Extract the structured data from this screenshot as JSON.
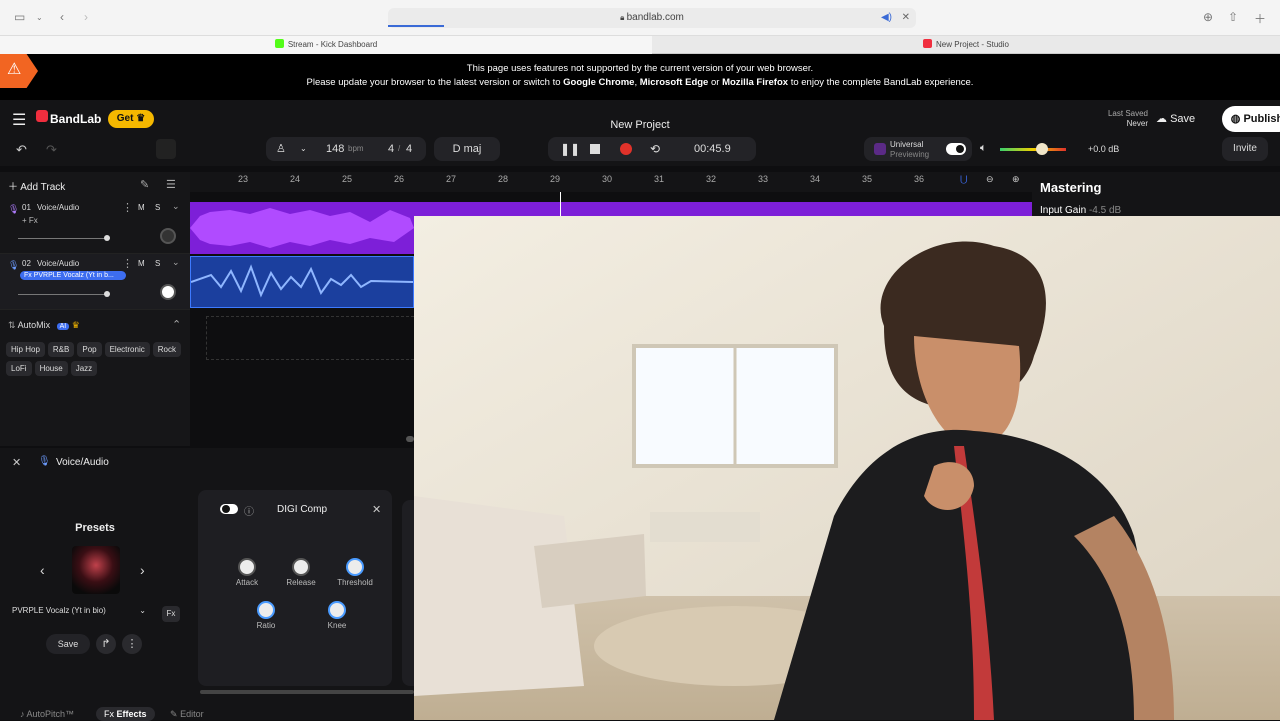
{
  "browser": {
    "url": "bandlab.com",
    "tabs": [
      {
        "label": "Stream - Kick Dashboard",
        "color": "#53fc18"
      },
      {
        "label": "New Project - Studio",
        "color": "#f02e3e"
      }
    ]
  },
  "notice": {
    "line1": "This page uses features not supported by the current version of your web browser.",
    "line2_a": "Please update your browser to the latest version or switch to ",
    "chrome": "Google Chrome",
    "comma": ", ",
    "edge": "Microsoft Edge",
    "or": " or ",
    "firefox": "Mozilla Firefox",
    "line2_b": " to enjoy the complete BandLab experience."
  },
  "header": {
    "brand": "BandLab",
    "get_label": "Get",
    "project_title": "New Project",
    "last_saved_label": "Last Saved",
    "last_saved_value": "Never",
    "save_label": "Save",
    "publish_label": "Publish",
    "invite_label": "Invite"
  },
  "transport": {
    "bpm": "148",
    "bpm_unit": "bpm",
    "time_sig_num": "4",
    "time_sig_sep": "/",
    "time_sig_den": "4",
    "key": "D maj",
    "time": "00:45.9",
    "universal_label": "Universal",
    "universal_sub": "Previewing",
    "volume_db": "+0.0 dB"
  },
  "tracks_panel": {
    "add_track": "Add Track",
    "tracks": [
      {
        "number": "01",
        "name": "Voice/Audio",
        "fx": "+ Fx",
        "m": "M",
        "s": "S"
      },
      {
        "number": "02",
        "name": "Voice/Audio",
        "fx": "Fx PVRPLE Vocalz (Yt in b...",
        "m": "M",
        "s": "S"
      }
    ],
    "automix_label": "AutoMix",
    "ai_badge": "AI",
    "genres_row1": [
      "Hip Hop",
      "R&B",
      "Pop",
      "Electronic",
      "Rock"
    ],
    "genres_row2": [
      "LoFi",
      "House",
      "Jazz"
    ]
  },
  "ruler": {
    "bars": [
      "23",
      "24",
      "25",
      "26",
      "27",
      "28",
      "29",
      "30",
      "31",
      "32",
      "33",
      "34",
      "35",
      "36"
    ]
  },
  "mastering": {
    "title": "Mastering",
    "input_gain_label": "Input Gain",
    "input_gain_value": "-4.5 dB"
  },
  "effects_panel": {
    "track_name": "Voice/Audio",
    "presets_label": "Presets",
    "preset_name": "PVRPLE Vocalz (Yt in bio)",
    "save_label": "Save",
    "fx_label": "Fx",
    "plugin_name": "DIGI Comp",
    "knobs_row1": [
      "Attack",
      "Release",
      "Threshold"
    ],
    "knobs_row2": [
      "Ratio",
      "Knee"
    ],
    "bottom_tabs": [
      "AutoPitch™",
      "Effects",
      "Editor"
    ],
    "bottom_tab_icons": [
      "",
      "Fx",
      ""
    ]
  },
  "colors": {
    "accent_orange": "#f26522",
    "clip_purple": "#7d1fd8",
    "clip_blue": "#1b3f9e",
    "record_red": "#e0322a",
    "get_yellow": "#f5b800"
  }
}
